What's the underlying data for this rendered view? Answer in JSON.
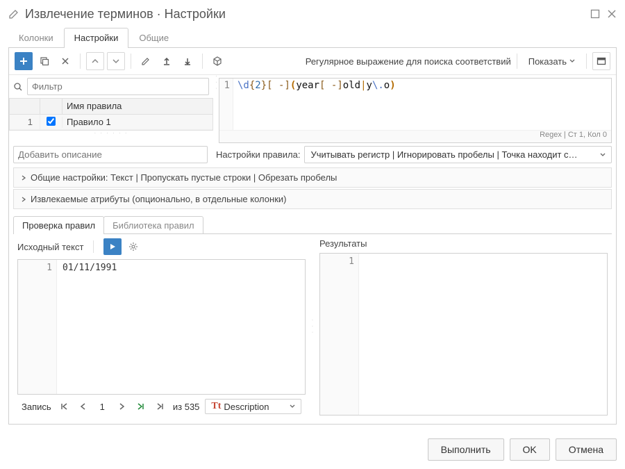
{
  "header": {
    "title": "Извлечение терминов · Настройки"
  },
  "tabs": {
    "columns": "Колонки",
    "settings": "Настройки",
    "general": "Общие"
  },
  "toolbar": {
    "regex_label": "Регулярное выражение для поиска соответствий",
    "show": "Показать"
  },
  "filter": {
    "placeholder": "Фильтр"
  },
  "rules_table": {
    "header_name": "Имя правила",
    "rows": [
      {
        "idx": "1",
        "checked": true,
        "name": "Правило 1"
      }
    ]
  },
  "regex": {
    "line_no": "1",
    "pattern_display": "\\d{2}[ -](year[ -]old|y\\.o)",
    "status": "Regex | Ст 1, Кол 0"
  },
  "desc": {
    "placeholder": "Добавить описание"
  },
  "rule_settings": {
    "label": "Настройки правила:",
    "value": "Учитывать регистр | Игнорировать пробелы | Точка находит с…"
  },
  "collapse1": "Общие настройки: Текст | Пропускать пустые строки | Обрезать пробелы",
  "collapse2": "Извлекаемые атрибуты (опционально, в отдельные колонки)",
  "lowtabs": {
    "check": "Проверка правил",
    "lib": "Библиотека правил"
  },
  "source_text": {
    "label": "Исходный текст",
    "line_no": "1",
    "value": "01/11/1991"
  },
  "results": {
    "label": "Результаты",
    "line_no": "1"
  },
  "record": {
    "label": "Запись",
    "current": "1",
    "of": "из 535",
    "column": "Description"
  },
  "footer": {
    "run": "Выполнить",
    "ok": "OK",
    "cancel": "Отмена"
  }
}
